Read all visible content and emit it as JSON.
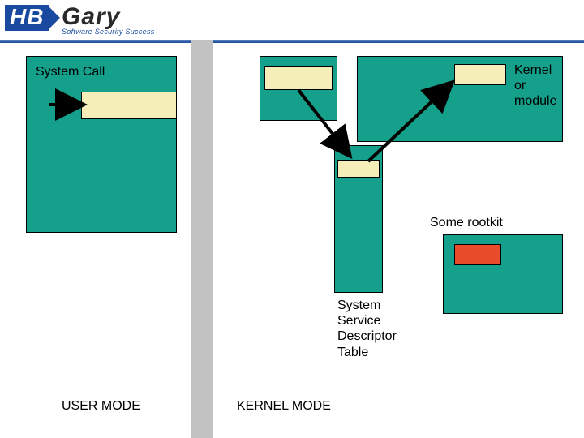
{
  "logo": {
    "hb": "HB",
    "gary": "Gary",
    "tagline": "Software Security Success"
  },
  "labels": {
    "system_call": "System Call",
    "kernel_or_module": "Kernel\nor\nmodule",
    "some_rootkit": "Some rootkit",
    "ssdt": "System\nService\nDescriptor\nTable",
    "user_mode": "USER MODE",
    "kernel_mode": "KERNEL MODE"
  },
  "colors": {
    "teal": "#14a08a",
    "cream": "#f5eeb8",
    "red": "#e84c2b",
    "grey": "#c2c2c2",
    "blue": "#1a4aa0"
  }
}
